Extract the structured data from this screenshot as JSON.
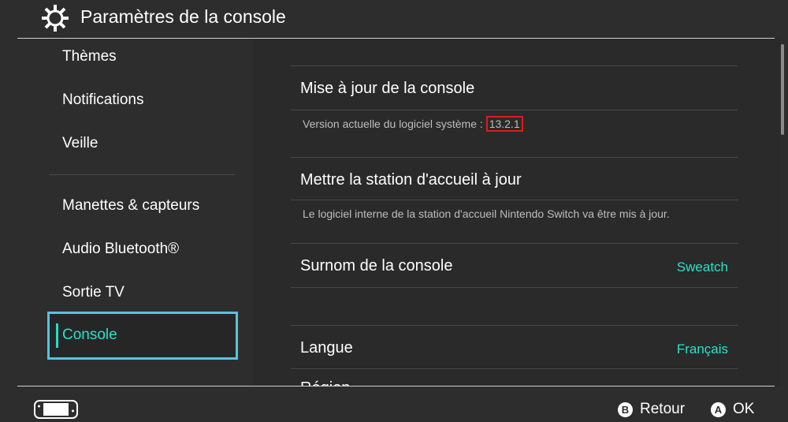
{
  "header": {
    "title": "Paramètres de la console",
    "icon": "gear-icon"
  },
  "sidebar": {
    "items": [
      {
        "label": "Thèmes"
      },
      {
        "label": "Notifications"
      },
      {
        "label": "Veille"
      },
      {
        "label": "Manettes & capteurs"
      },
      {
        "label": "Audio Bluetooth®"
      },
      {
        "label": "Sortie TV"
      },
      {
        "label": "Console",
        "selected": true
      }
    ],
    "selected_border_color": "#51c7dd",
    "selected_text_color": "#2ee0c8"
  },
  "main": {
    "rows": [
      {
        "title": "Mise à jour de la console",
        "description_prefix": "Version actuelle du logiciel système : ",
        "version": "13.2.1"
      },
      {
        "title": "Mettre la station d'accueil à jour",
        "description": "Le logiciel interne de la station d'accueil Nintendo Switch va être mis à jour."
      },
      {
        "title": "Surnom de la console",
        "value": "Sweatch"
      },
      {
        "title": "Langue",
        "value": "Français"
      },
      {
        "title": "Région"
      }
    ],
    "value_color": "#2ee0c8",
    "highlight_color": "#e11a1a"
  },
  "footer": {
    "console_icon": "switch-console-icon",
    "buttons": [
      {
        "key": "B",
        "label": "Retour"
      },
      {
        "key": "A",
        "label": "OK"
      }
    ]
  }
}
